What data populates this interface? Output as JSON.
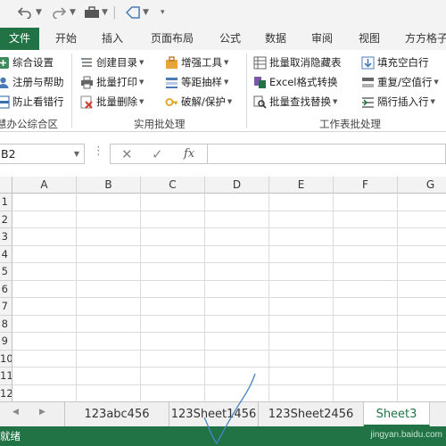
{
  "colors": {
    "accent": "#217346",
    "ribbon_bg": "#f3f3f3"
  },
  "qat": {
    "icons": [
      "undo-icon",
      "redo-icon",
      "toolbox-icon",
      "shape-icon",
      "customize-icon"
    ]
  },
  "tabs": {
    "items": [
      {
        "label": "文件",
        "active": true
      },
      {
        "label": "开始"
      },
      {
        "label": "插入"
      },
      {
        "label": "页面布局"
      },
      {
        "label": "公式"
      },
      {
        "label": "数据"
      },
      {
        "label": "审阅"
      },
      {
        "label": "视图"
      },
      {
        "label": "方方格子"
      }
    ]
  },
  "ribbon": {
    "left_group": {
      "items": [
        "综合设置",
        "注册与帮助",
        "防止看错行"
      ],
      "label": "慧办公综合区"
    },
    "batch_group": {
      "col1": [
        "创建目录",
        "批量打印",
        "批量删除"
      ],
      "col2": [
        "增强工具",
        "等距抽样",
        "破解/保护"
      ],
      "label": "实用批处理"
    },
    "sheet_group": {
      "col1": [
        "批量取消隐藏表",
        "Excel格式转换",
        "批量查找替换"
      ],
      "col2": [
        "填充空白行",
        "重复/空值行",
        "隔行插入行"
      ],
      "label": "工作表批处理"
    }
  },
  "formula_bar": {
    "name_box": "B2",
    "function_label": "fx",
    "value": ""
  },
  "grid": {
    "columns": [
      "A",
      "B",
      "C",
      "D",
      "E",
      "F",
      "G"
    ],
    "rows": [
      "1",
      "2",
      "3",
      "4",
      "5",
      "6",
      "7",
      "8",
      "9",
      "10",
      "11",
      "12"
    ]
  },
  "sheets": {
    "tabs": [
      {
        "label": "123abc456"
      },
      {
        "label": "123Sheet1456"
      },
      {
        "label": "123Sheet2456"
      },
      {
        "label": "Sheet3",
        "active": true
      }
    ]
  },
  "status": {
    "text": "就绪",
    "watermark": "jingyan.baidu.com"
  }
}
